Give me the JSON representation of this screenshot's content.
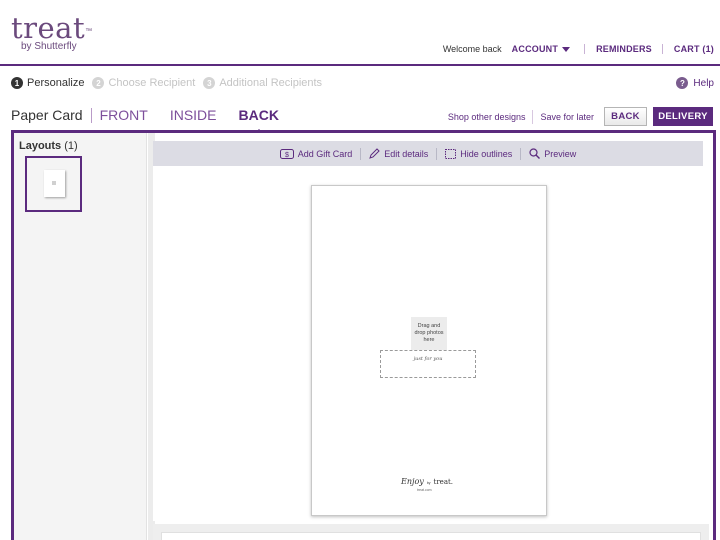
{
  "brand": {
    "logo_word": "treat",
    "logo_mark": "™",
    "logo_sub": "by Shutterfly",
    "accent_color": "#5b2a7e"
  },
  "topnav": {
    "welcome": "Welcome back",
    "account": "ACCOUNT",
    "reminders": "REMINDERS",
    "cart": "CART (1)"
  },
  "steps": [
    {
      "num": "1",
      "label": "Personalize",
      "active": true
    },
    {
      "num": "2",
      "label": "Choose Recipient",
      "active": false
    },
    {
      "num": "3",
      "label": "Additional Recipients",
      "active": false
    }
  ],
  "help": {
    "icon": "?",
    "label": "Help"
  },
  "card_nav": {
    "product": "Paper Card",
    "tabs": [
      {
        "label": "FRONT",
        "active": false
      },
      {
        "label": "INSIDE",
        "active": false
      },
      {
        "label": "BACK",
        "active": true
      }
    ]
  },
  "actions": {
    "shop_other": "Shop other designs",
    "save_later": "Save for later",
    "back": "BACK",
    "delivery": "DELIVERY"
  },
  "layouts_panel": {
    "title": "Layouts",
    "count": "(1)",
    "thumb_icon": "layout-thumbnail"
  },
  "toolbar": {
    "add_gift_card": "Add Gift Card",
    "edit_details": "Edit details",
    "hide_outlines": "Hide outlines",
    "preview": "Preview"
  },
  "card_canvas": {
    "photo_slot": "Drag and drop photos here",
    "text_box": "just for you",
    "logo_script": "Enjoy",
    "logo_by": "by",
    "logo_brand": "treat.",
    "logo_url": "treat.com"
  }
}
